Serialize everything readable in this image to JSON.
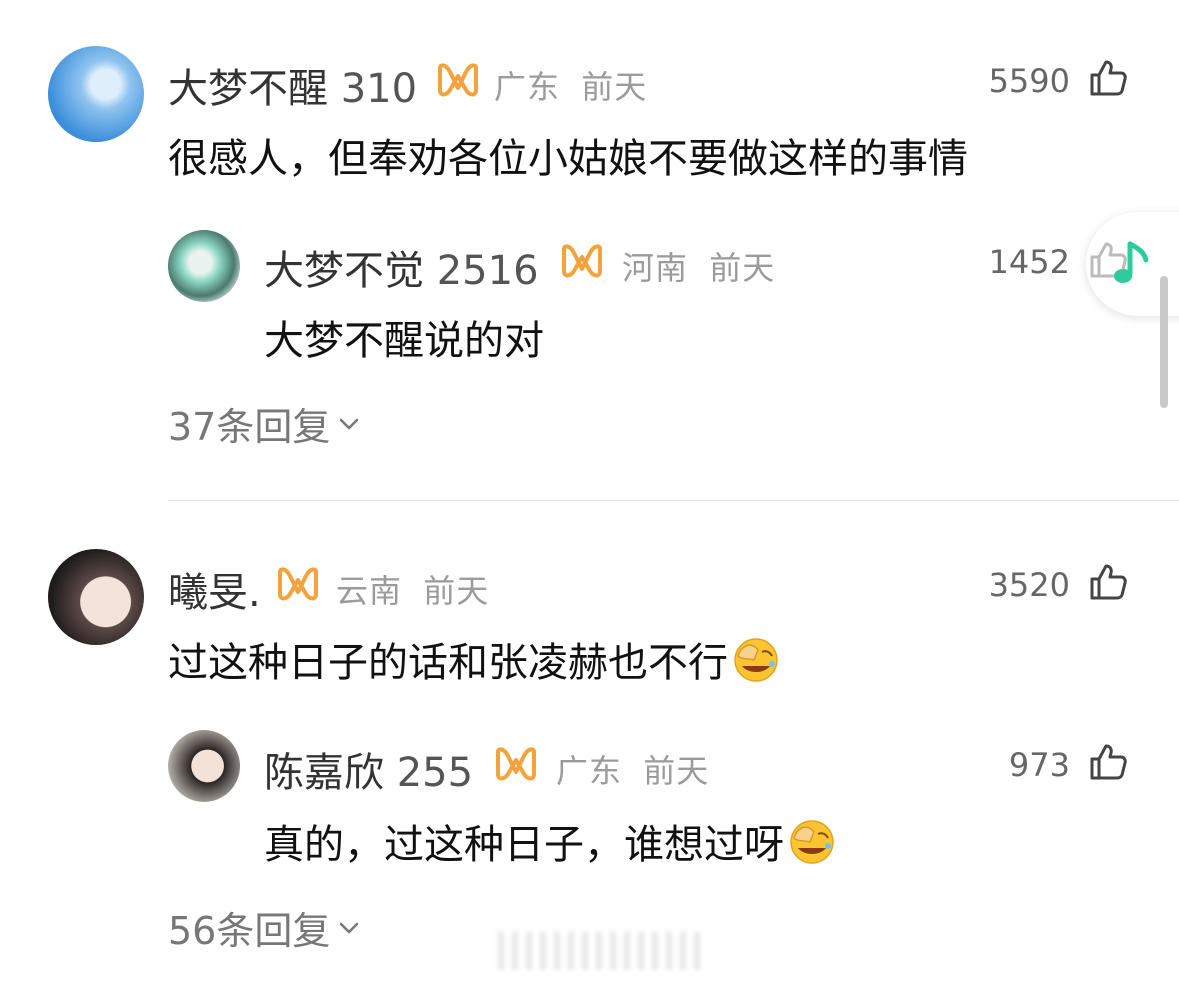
{
  "comments": [
    {
      "username": "大梦不醒",
      "level": "310",
      "location": "广东",
      "time": "前天",
      "likes": "5590",
      "text": "很感人，但奉劝各位小姑娘不要做这样的事情",
      "reply": {
        "username": "大梦不觉",
        "level": "2516",
        "location": "河南",
        "time": "前天",
        "likes": "1452",
        "text": "大梦不醒说的对"
      },
      "reply_count_label": "37条回复"
    },
    {
      "username": "曦旻.",
      "level": "",
      "location": "云南",
      "time": "前天",
      "likes": "3520",
      "text": "过这种日子的话和张凌赫也不行",
      "reply": {
        "username": "陈嘉欣",
        "level": "255",
        "location": "广东",
        "time": "前天",
        "likes": "973",
        "text": "真的，过这种日子，谁想过呀"
      },
      "reply_count_label": "56条回复"
    }
  ],
  "colors": {
    "badge": "#f4a23c",
    "music_icon": "#2ecb9c",
    "meta": "#9b9b9b",
    "divider": "#e6e6e6"
  },
  "icons": {
    "like": "thumbs-up-icon",
    "badge": "vip-badge-icon",
    "emoji": "face-palm-laughing-emoji",
    "music": "music-note-icon",
    "expand": "chevron-down-icon"
  }
}
